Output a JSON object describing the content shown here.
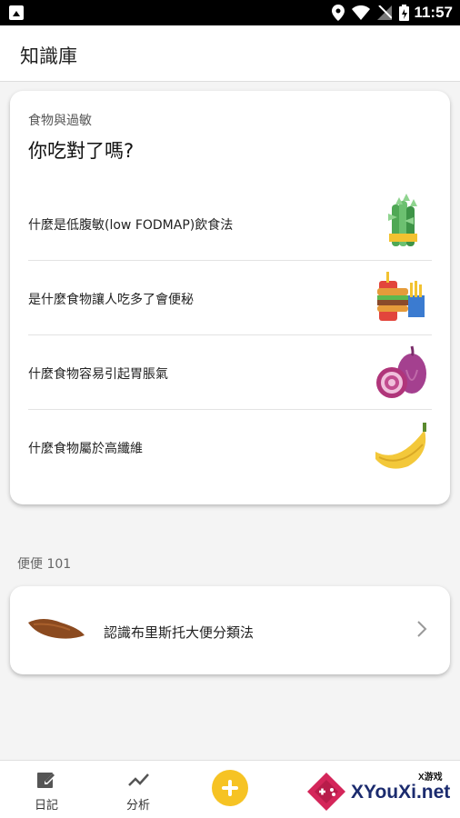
{
  "status_bar": {
    "time": "11:57"
  },
  "app_bar": {
    "title": "知識庫"
  },
  "food_card": {
    "subtitle": "食物與過敏",
    "heading": "你吃對了嗎?",
    "items": [
      {
        "label": "什麼是低腹敏(low FODMAP)飲食法",
        "icon": "asparagus-icon"
      },
      {
        "label": "是什麼食物讓人吃多了會便秘",
        "icon": "fast-food-icon"
      },
      {
        "label": "什麼食物容易引起胃脹氣",
        "icon": "red-onion-icon"
      },
      {
        "label": "什麼食物屬於高纖維",
        "icon": "banana-icon"
      }
    ]
  },
  "poop_section": {
    "label": "便便 101",
    "item": {
      "label": "認識布里斯托大便分類法",
      "icon": "poop-icon"
    }
  },
  "bottom_nav": {
    "items": [
      {
        "label": "日記",
        "icon": "edit-icon"
      },
      {
        "label": "分析",
        "icon": "chart-line-icon"
      }
    ],
    "add_icon": "plus-icon"
  },
  "watermark": {
    "small": "X游戏",
    "main": "XYouXi.net"
  },
  "colors": {
    "accent": "#f6c324",
    "card_bg": "#ffffff",
    "background": "#f4f4f4"
  }
}
